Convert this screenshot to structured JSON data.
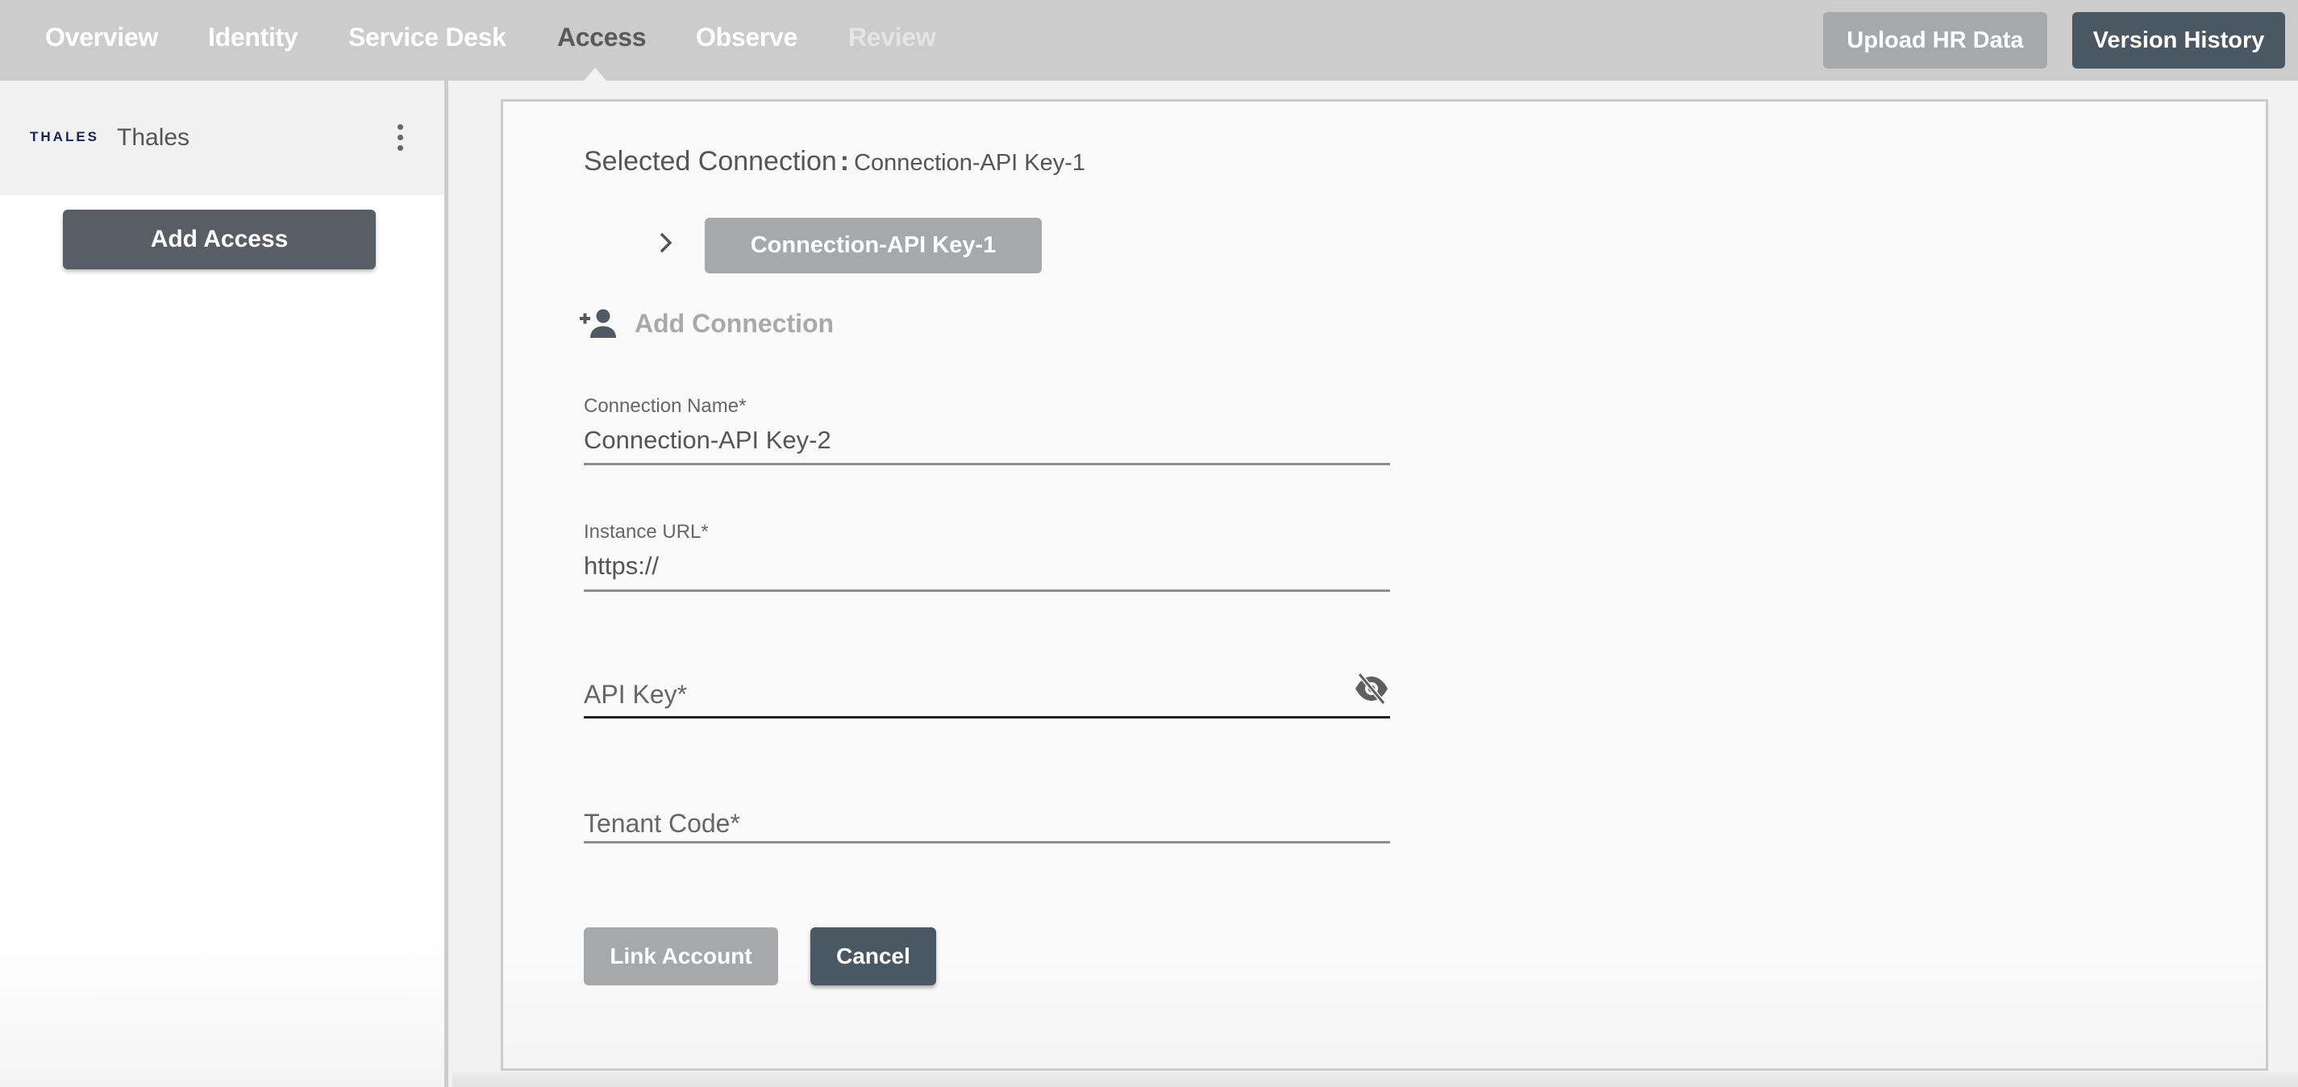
{
  "nav": {
    "tabs": [
      {
        "label": "Overview",
        "state": "normal"
      },
      {
        "label": "Identity",
        "state": "normal"
      },
      {
        "label": "Service Desk",
        "state": "normal"
      },
      {
        "label": "Access",
        "state": "active"
      },
      {
        "label": "Observe",
        "state": "normal"
      },
      {
        "label": "Review",
        "state": "disabled"
      }
    ],
    "upload_hr_data_label": "Upload HR Data",
    "version_history_label": "Version History"
  },
  "sidebar": {
    "logo_text": "THALES",
    "org_name": "Thales",
    "more_icon": "more-vertical-icon",
    "add_access_label": "Add Access"
  },
  "main": {
    "selected_connection_label": "Selected Connection",
    "selected_connection_colon": ":",
    "selected_connection_value": "Connection-API Key-1",
    "connections": [
      {
        "label": "Connection-API Key-1"
      }
    ],
    "expand_icon": "chevron-right-icon",
    "add_connection_icon": "person-add-icon",
    "add_connection_label": "Add Connection",
    "form": {
      "connection_name": {
        "label": "Connection Name*",
        "value": "Connection-API Key-2"
      },
      "instance_url": {
        "label": "Instance URL*",
        "value": "https://"
      },
      "api_key": {
        "placeholder": "API Key*",
        "value": "",
        "toggle_icon": "eye-off-icon"
      },
      "tenant_code": {
        "placeholder": "Tenant Code*",
        "value": ""
      }
    },
    "link_account_label": "Link Account",
    "cancel_label": "Cancel"
  },
  "colors": {
    "topbar_bg": "#cccccc",
    "primary_dark": "#4a5864",
    "disabled_gray": "#a7a8a9",
    "sidebar_button": "#575e66",
    "logo_navy": "#1b1f5e"
  }
}
